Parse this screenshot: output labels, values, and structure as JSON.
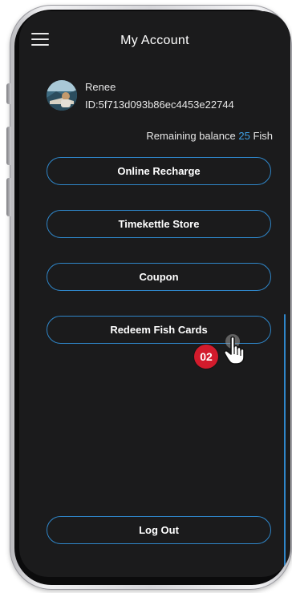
{
  "header": {
    "title": "My Account",
    "menu_icon": "hamburger-menu-icon"
  },
  "profile": {
    "name": "Renee",
    "id": "ID:5f713d093b86ec4453e22744",
    "avatar_icon": "avatar-image"
  },
  "balance": {
    "label": "Remaining balance",
    "amount": "25",
    "unit": "Fish"
  },
  "buttons": {
    "online_recharge": "Online Recharge",
    "timekettle_store": "Timekettle Store",
    "coupon": "Coupon",
    "redeem_fish_cards": "Redeem Fish Cards",
    "log_out": "Log Out"
  },
  "annotation": {
    "step": "02",
    "cursor_icon": "hand-pointer-icon"
  },
  "colors": {
    "accent": "#2f86c9",
    "balance_number": "#3fa2e8",
    "background": "#1b1b1c",
    "badge": "#d21b2c"
  }
}
